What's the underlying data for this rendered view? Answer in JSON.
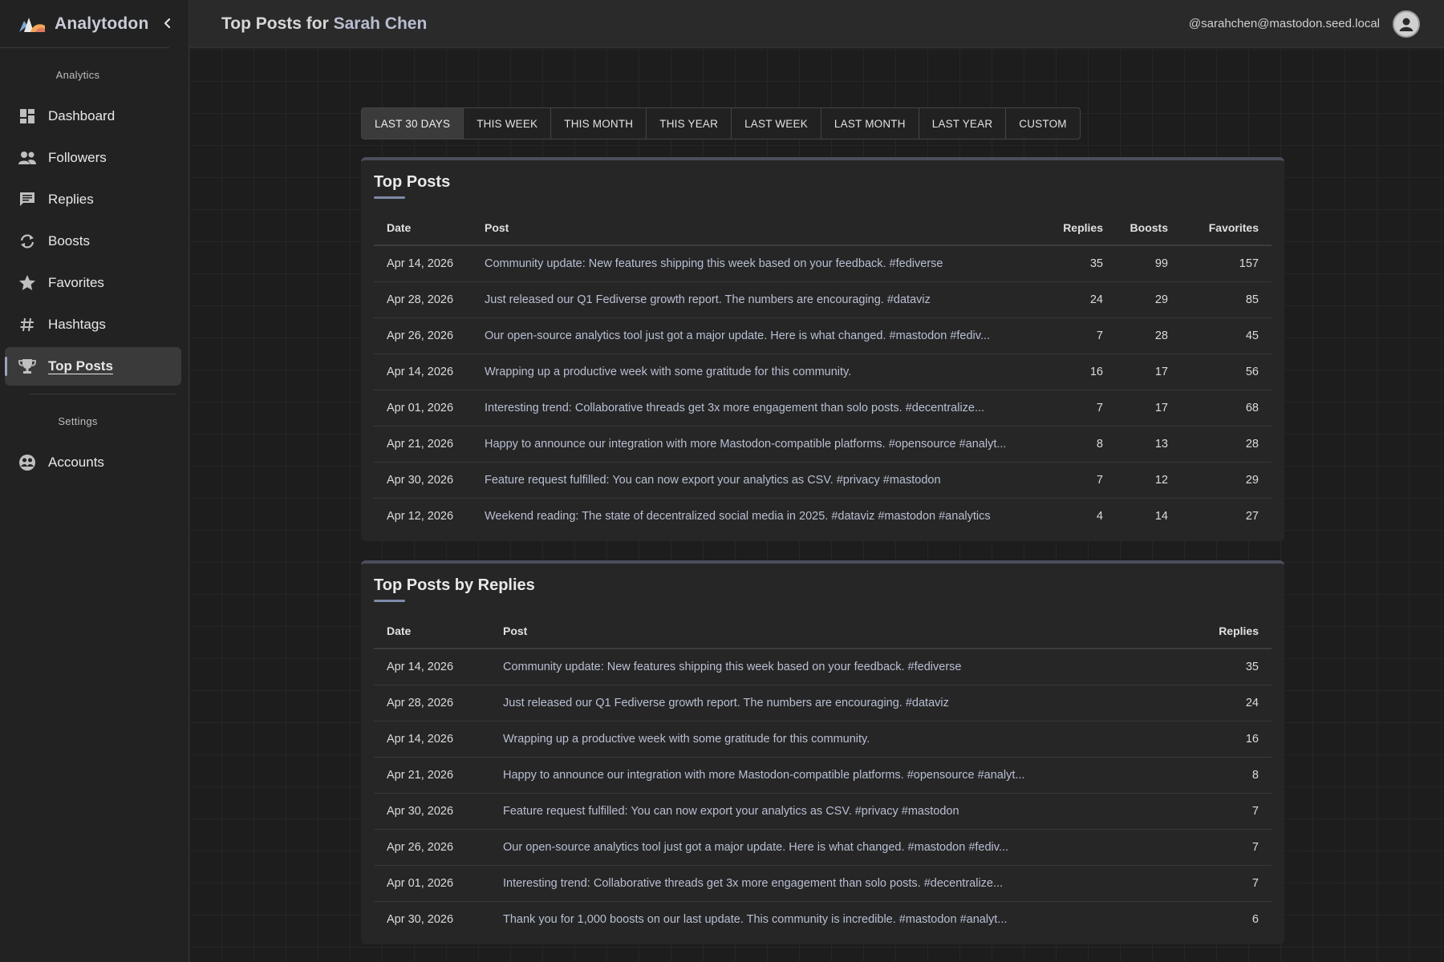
{
  "app": {
    "name": "Analytodon"
  },
  "sidebar": {
    "analytics_title": "Analytics",
    "settings_title": "Settings",
    "items": [
      {
        "label": "Dashboard",
        "icon": "dashboard-icon"
      },
      {
        "label": "Followers",
        "icon": "people-icon"
      },
      {
        "label": "Replies",
        "icon": "comment-icon"
      },
      {
        "label": "Boosts",
        "icon": "boost-icon"
      },
      {
        "label": "Favorites",
        "icon": "star-icon"
      },
      {
        "label": "Hashtags",
        "icon": "hashtag-icon"
      },
      {
        "label": "Top Posts",
        "icon": "trophy-icon",
        "active": true
      }
    ],
    "settings_items": [
      {
        "label": "Accounts",
        "icon": "accounts-icon"
      }
    ]
  },
  "header": {
    "title_prefix": "Top Posts for ",
    "title_name": "Sarah Chen",
    "user_handle": "@sarahchen@mastodon.seed.local"
  },
  "tabs": [
    {
      "label": "LAST 30 DAYS",
      "active": true
    },
    {
      "label": "THIS WEEK"
    },
    {
      "label": "THIS MONTH"
    },
    {
      "label": "THIS YEAR"
    },
    {
      "label": "LAST WEEK"
    },
    {
      "label": "LAST MONTH"
    },
    {
      "label": "LAST YEAR"
    },
    {
      "label": "CUSTOM"
    }
  ],
  "top_posts": {
    "title": "Top Posts",
    "columns": {
      "date": "Date",
      "post": "Post",
      "replies": "Replies",
      "boosts": "Boosts",
      "favorites": "Favorites"
    },
    "rows": [
      {
        "date": "Apr 14, 2026",
        "post": "Community update: New features shipping this week based on your feedback. #fediverse",
        "replies": "35",
        "boosts": "99",
        "favorites": "157"
      },
      {
        "date": "Apr 28, 2026",
        "post": "Just released our Q1 Fediverse growth report. The numbers are encouraging. #dataviz",
        "replies": "24",
        "boosts": "29",
        "favorites": "85"
      },
      {
        "date": "Apr 26, 2026",
        "post": "Our open-source analytics tool just got a major update. Here is what changed. #mastodon #fediv...",
        "replies": "7",
        "boosts": "28",
        "favorites": "45"
      },
      {
        "date": "Apr 14, 2026",
        "post": "Wrapping up a productive week with some gratitude for this community.",
        "replies": "16",
        "boosts": "17",
        "favorites": "56"
      },
      {
        "date": "Apr 01, 2026",
        "post": "Interesting trend: Collaborative threads get 3x more engagement than solo posts. #decentralize...",
        "replies": "7",
        "boosts": "17",
        "favorites": "68"
      },
      {
        "date": "Apr 21, 2026",
        "post": "Happy to announce our integration with more Mastodon-compatible platforms. #opensource #analyt...",
        "replies": "8",
        "boosts": "13",
        "favorites": "28"
      },
      {
        "date": "Apr 30, 2026",
        "post": "Feature request fulfilled: You can now export your analytics as CSV. #privacy #mastodon",
        "replies": "7",
        "boosts": "12",
        "favorites": "29"
      },
      {
        "date": "Apr 12, 2026",
        "post": "Weekend reading: The state of decentralized social media in 2025. #dataviz #mastodon #analytics",
        "replies": "4",
        "boosts": "14",
        "favorites": "27"
      }
    ]
  },
  "top_by_replies": {
    "title": "Top Posts by Replies",
    "columns": {
      "date": "Date",
      "post": "Post",
      "replies": "Replies"
    },
    "rows": [
      {
        "date": "Apr 14, 2026",
        "post": "Community update: New features shipping this week based on your feedback. #fediverse",
        "replies": "35"
      },
      {
        "date": "Apr 28, 2026",
        "post": "Just released our Q1 Fediverse growth report. The numbers are encouraging. #dataviz",
        "replies": "24"
      },
      {
        "date": "Apr 14, 2026",
        "post": "Wrapping up a productive week with some gratitude for this community.",
        "replies": "16"
      },
      {
        "date": "Apr 21, 2026",
        "post": "Happy to announce our integration with more Mastodon-compatible platforms. #opensource #analyt...",
        "replies": "8"
      },
      {
        "date": "Apr 30, 2026",
        "post": "Feature request fulfilled: You can now export your analytics as CSV. #privacy #mastodon",
        "replies": "7"
      },
      {
        "date": "Apr 26, 2026",
        "post": "Our open-source analytics tool just got a major update. Here is what changed. #mastodon #fediv...",
        "replies": "7"
      },
      {
        "date": "Apr 01, 2026",
        "post": "Interesting trend: Collaborative threads get 3x more engagement than solo posts. #decentralize...",
        "replies": "7"
      },
      {
        "date": "Apr 30, 2026",
        "post": "Thank you for 1,000 boosts on our last update. This community is incredible. #mastodon #analyt...",
        "replies": "6"
      }
    ]
  }
}
